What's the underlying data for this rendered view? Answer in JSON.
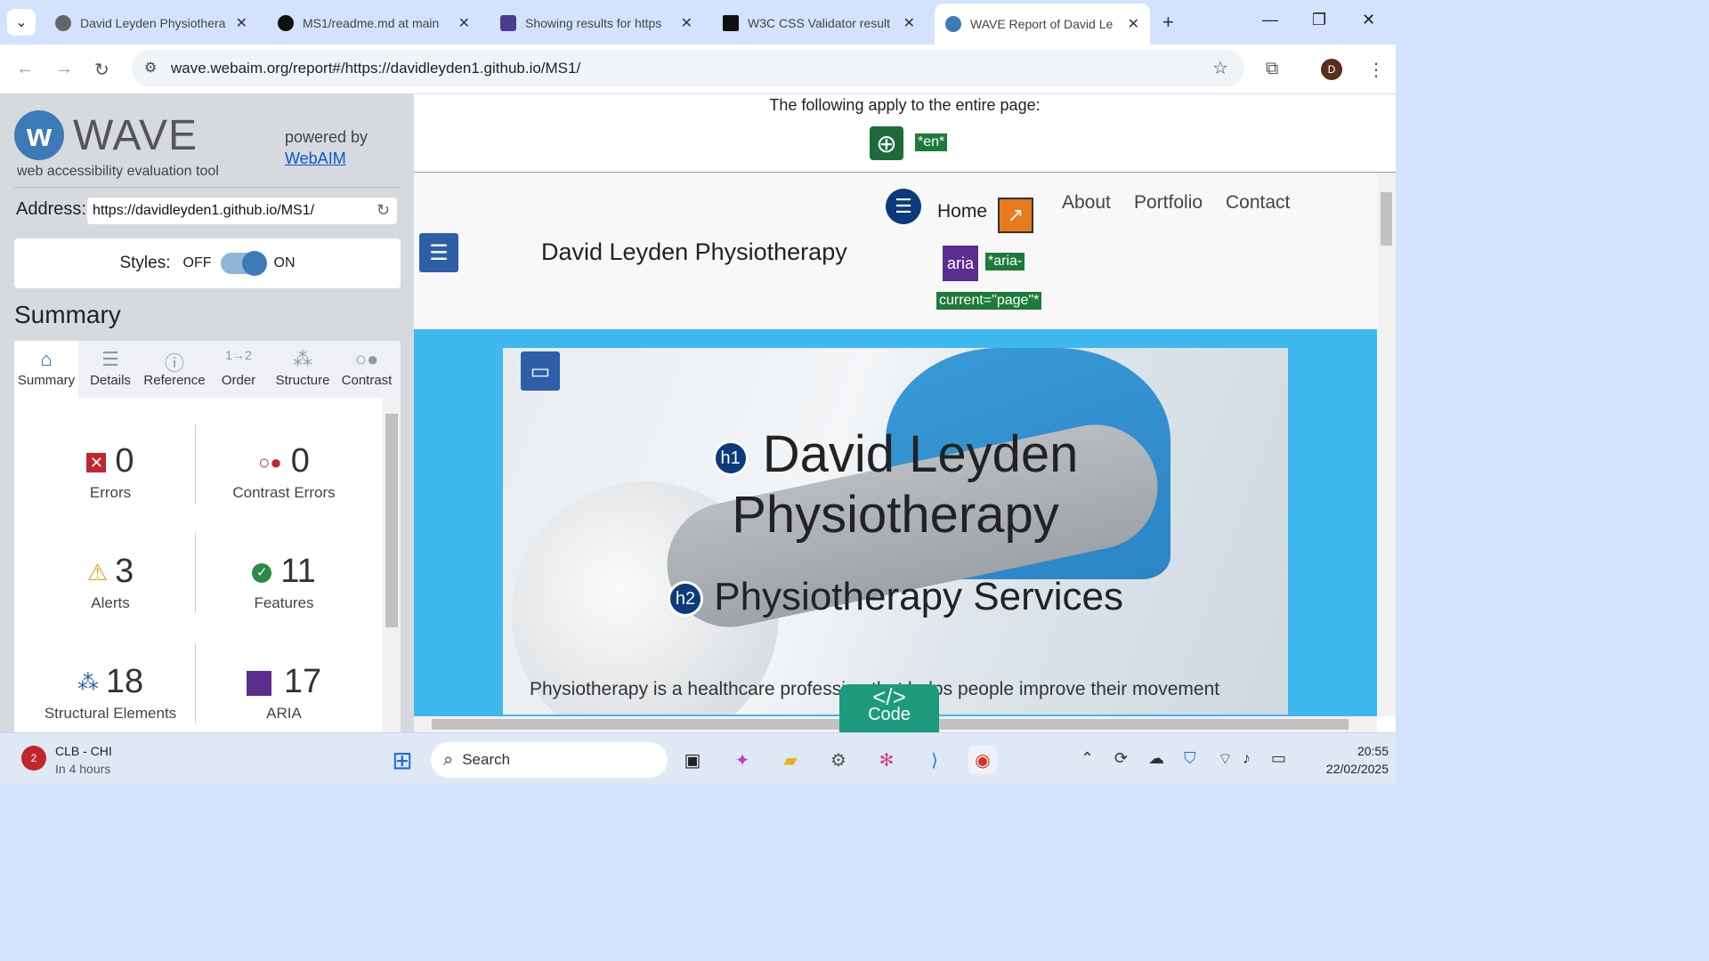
{
  "browser": {
    "tabs": [
      {
        "title": "David Leyden Physiothera",
        "active": false
      },
      {
        "title": "MS1/readme.md at main",
        "active": false
      },
      {
        "title": "Showing results for https",
        "active": false
      },
      {
        "title": "W3C CSS Validator result",
        "active": false
      },
      {
        "title": "WAVE Report of David Le",
        "active": true
      }
    ],
    "url": "wave.webaim.org/report#/https://davidleyden1.github.io/MS1/",
    "profile": "D"
  },
  "wave": {
    "name": "WAVE",
    "tagline": "web accessibility evaluation tool",
    "powered_by": "powered by",
    "powered_link": "WebAIM",
    "address_label": "Address:",
    "address_value": "https://davidleyden1.github.io/MS1/",
    "styles_label": "Styles:",
    "styles_off": "OFF",
    "styles_on": "ON",
    "summary_heading": "Summary",
    "tabs": [
      "Summary",
      "Details",
      "Reference",
      "Order",
      "Structure",
      "Contrast"
    ],
    "stats": [
      {
        "value": "0",
        "label": "Errors"
      },
      {
        "value": "0",
        "label": "Contrast Errors"
      },
      {
        "value": "3",
        "label": "Alerts"
      },
      {
        "value": "11",
        "label": "Features"
      },
      {
        "value": "18",
        "label": "Structural Elements"
      },
      {
        "value": "17",
        "label": "ARIA"
      }
    ]
  },
  "page": {
    "entire_note": "The following apply to the entire page:",
    "lang_tag": "*en*",
    "site_title": "David Leyden Physiotherapy",
    "nav": [
      "Home",
      "About",
      "Portfolio",
      "Contact"
    ],
    "aria_icon": "aria",
    "aria_tag1": "*aria-",
    "aria_tag2": "current=\"page\"*",
    "h1_badge": "h1",
    "h1_line1": "David Leyden",
    "h1_line2": "Physiotherapy",
    "h2_badge": "h2",
    "h2": "Physiotherapy Services",
    "para": "Physiotherapy is a healthcare profession that helps people improve their movement",
    "code_label": "Code"
  },
  "taskbar": {
    "weather_title": "CLB - CHI",
    "weather_sub": "In 4 hours",
    "search": "Search",
    "time": "20:55",
    "date": "22/02/2025"
  }
}
